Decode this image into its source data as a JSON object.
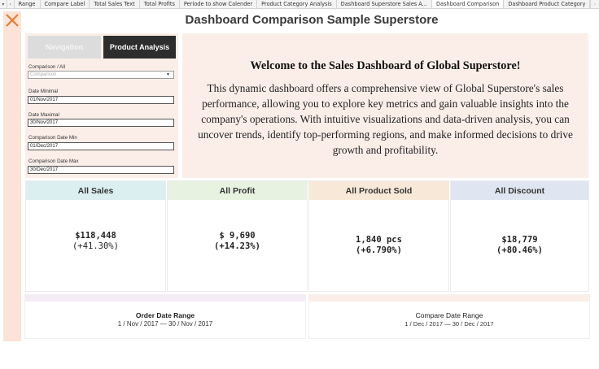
{
  "tabs": [
    {
      "label": "Range",
      "active": false
    },
    {
      "label": "Compare Label",
      "active": false
    },
    {
      "label": "Total Sales Text",
      "active": false
    },
    {
      "label": "Total Profits",
      "active": false
    },
    {
      "label": "Periode to show Calender",
      "active": false
    },
    {
      "label": "Product Category Analysis",
      "active": false
    },
    {
      "label": "Dashboard Superstore Sales A...",
      "active": false
    },
    {
      "label": "Dashboard Comparison",
      "active": true
    },
    {
      "label": "Dashboard Product Category",
      "active": false
    }
  ],
  "title": "Dashboard Comparison Sample Superstore",
  "controls": {
    "navigation_label": "Navigation",
    "product_analysis_label": "Product Analysis",
    "comparison_label": "Comparison / All",
    "comparison_value": "Comparison",
    "date_min_label": "Date Minimal",
    "date_min_value": "01/Nov/2017",
    "date_max_label": "Date Maximal",
    "date_max_value": "30/Nov/2017",
    "cmp_min_label": "Comparison Date Min",
    "cmp_min_value": "01/Dec/2017",
    "cmp_max_label": "Comparison Date Max",
    "cmp_max_value": "30/Dec/2017"
  },
  "welcome": {
    "heading": "Welcome to the Sales Dashboard of Global Superstore!",
    "body": "This dynamic dashboard offers a comprehensive view of Global Superstore's sales performance, allowing you to explore key metrics and gain valuable insights into the company's operations. With intuitive visualizations and data-driven analysis, you can uncover trends, identify top-performing regions, and make informed decisions to drive growth and profitability."
  },
  "cards": [
    {
      "label": "All Sales",
      "value": "$118,448",
      "change": "(+41.30%)",
      "color": "#dbeef0"
    },
    {
      "label": "All Profit",
      "value": "$ 9,690",
      "change": "(+14.23%)",
      "color": "#e8f2e1"
    },
    {
      "label": "All Product Sold",
      "value": "1,840 pcs",
      "change": "(+6.790%)",
      "color": "#f8e8d7"
    },
    {
      "label": "All Discount",
      "value": "$18,779",
      "change": "(+80.46%)",
      "color": "#e0e6f1"
    }
  ],
  "ranges": {
    "order_label": "Order Date Range",
    "order_value": "1 / Nov / 2017 — 30 / Nov / 2017",
    "compare_label": "Compare Date Range",
    "compare_value": "1 / Dec / 2017 — 30 / Dec / 2017"
  },
  "colors": {
    "rail": "#fbe3d7",
    "close_icon": "#e87a2a",
    "panel": "#fbeee8"
  }
}
